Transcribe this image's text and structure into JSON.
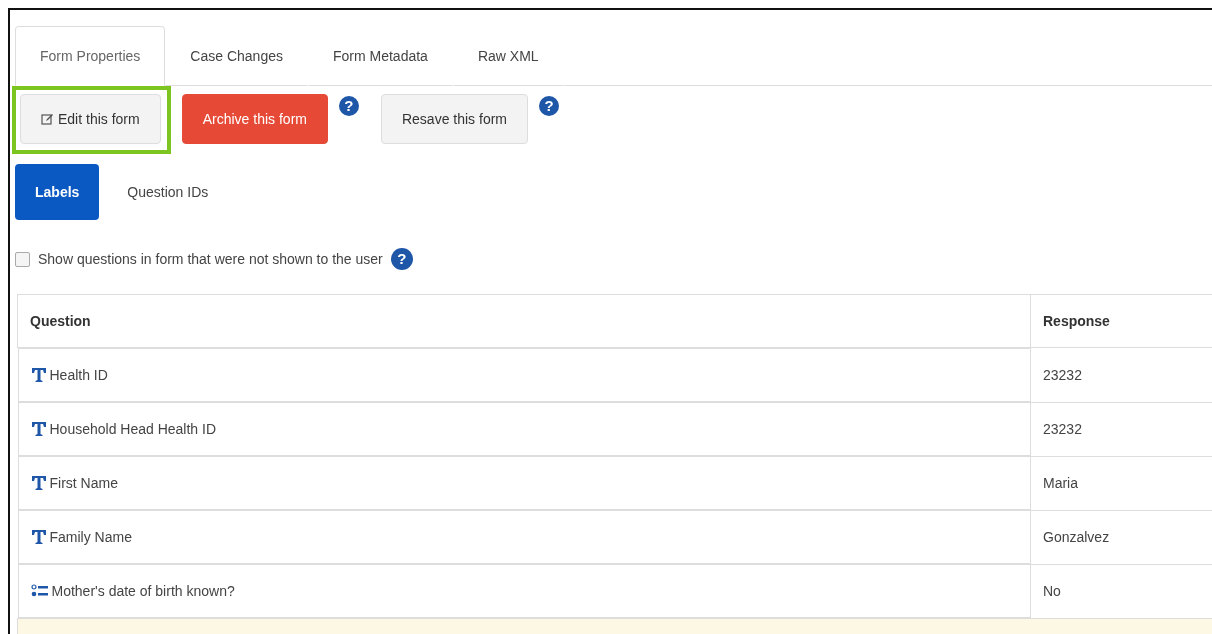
{
  "tabs": [
    {
      "label": "Form Properties",
      "selected": true
    },
    {
      "label": "Case Changes",
      "selected": false
    },
    {
      "label": "Form Metadata",
      "selected": false
    },
    {
      "label": "Raw XML",
      "selected": false
    }
  ],
  "actions": [
    {
      "label": "Edit this form",
      "kind": "edit",
      "highlighted": true
    },
    {
      "label": "Archive this form",
      "kind": "danger",
      "highlighted": false,
      "help": "?"
    },
    {
      "label": "Resave this form",
      "kind": "default",
      "highlighted": false,
      "help": "?"
    }
  ],
  "view_pills": [
    {
      "label": "Labels",
      "selected": true
    },
    {
      "label": "Question IDs",
      "selected": false
    }
  ],
  "show_hidden": {
    "label": "Show questions in form that were not shown to the user",
    "checked": false,
    "help": "?"
  },
  "table": {
    "columns": [
      "Question",
      "Response"
    ],
    "rows": [
      {
        "kind": "text",
        "question": "Health ID",
        "response": "23232"
      },
      {
        "kind": "text",
        "question": "Household Head Health ID",
        "response": "23232"
      },
      {
        "kind": "text",
        "question": "First Name",
        "response": "Maria"
      },
      {
        "kind": "text",
        "question": "Family Name",
        "response": "Gonzalvez"
      },
      {
        "kind": "select",
        "question": "Mother's date of birth known?",
        "response": "No"
      }
    ]
  }
}
